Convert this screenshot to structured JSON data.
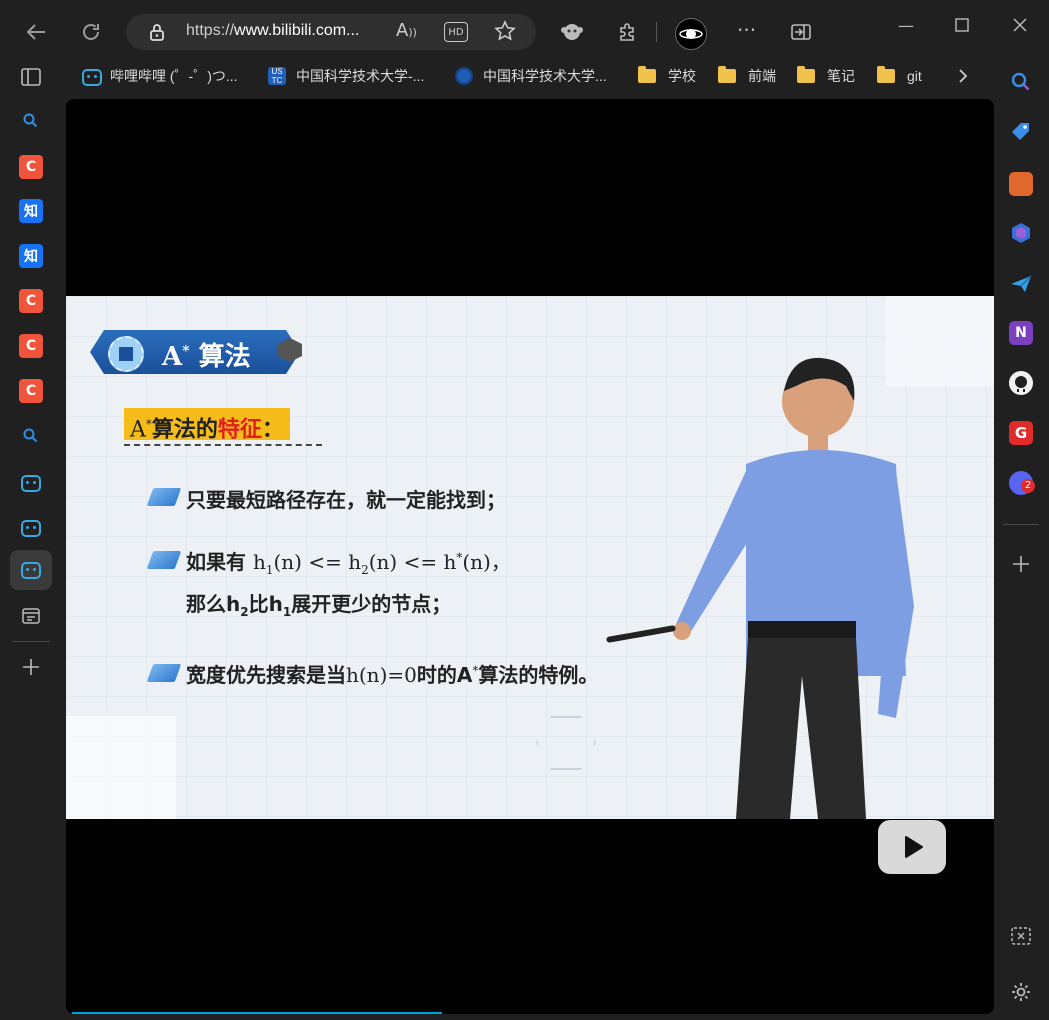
{
  "browser": {
    "url_prefix": "https://",
    "url_host": "www.bilibili.com...",
    "read_aloud": "A",
    "hd_badge": "HD"
  },
  "bookmarks": [
    {
      "label": "哔哩哔哩 (゜-゜)つ...",
      "icon": "bilibili-icon"
    },
    {
      "label": "中国科学技术大学-...",
      "icon": "ustc-icon"
    },
    {
      "label": "中国科学技术大学...",
      "icon": "ustc-globe-icon"
    },
    {
      "label": "学校",
      "icon": "folder-icon"
    },
    {
      "label": "前端",
      "icon": "folder-icon"
    },
    {
      "label": "笔记",
      "icon": "folder-icon"
    },
    {
      "label": "git",
      "icon": "folder-icon"
    }
  ],
  "sidebar": {
    "c_label": "C",
    "zhi_label": "知"
  },
  "right_sidebar": {
    "badge": "2",
    "office_label": "N",
    "g_label": "G"
  },
  "slide": {
    "title": "A* 算法",
    "title_main": "A",
    "title_sup": "*",
    "title_cn": "算法",
    "heading_a": "A",
    "heading_sup": "*",
    "heading_pre": "算法的",
    "heading_red": "特征",
    "heading_colon": "：",
    "bullet1": "只要最短路径存在，就一定能找到；",
    "bullet2_pre": "如果有",
    "bullet2_h1": "h",
    "bullet2_s1": "1",
    "bullet2_mid1": "(n) <= h",
    "bullet2_s2": "2",
    "bullet2_mid2": "(n) <= h",
    "bullet2_star": "*",
    "bullet2_end": "(n)，",
    "bullet2b_pre": "那么h",
    "bullet2b_s2": "2",
    "bullet2b_mid": "比h",
    "bullet2b_s1": "1",
    "bullet2b_end": "展开更少的节点；",
    "bullet3_pre": "宽度优先搜索是当",
    "bullet3_formula": "h(n)=0",
    "bullet3_mid": "时的A",
    "bullet3_sup": "*",
    "bullet3_end": "算法的特例。"
  }
}
